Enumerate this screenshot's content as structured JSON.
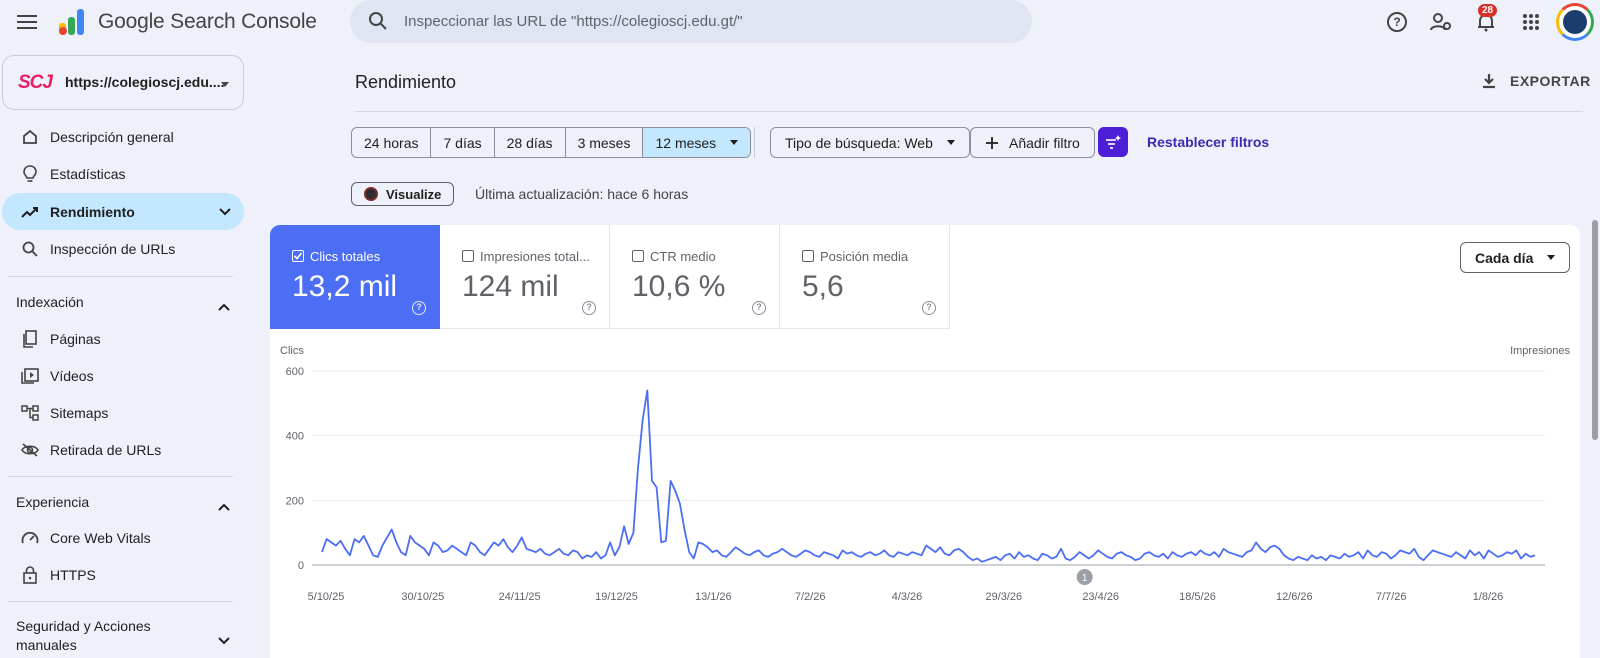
{
  "app": {
    "title": "Google Search Console"
  },
  "search": {
    "placeholder": "Inspeccionar las URL de \"https://colegioscj.edu.gt/\""
  },
  "header": {
    "notifications_count": "28"
  },
  "property": {
    "logo_text": "SCJ",
    "url": "https://colegioscj.edu...."
  },
  "sidebar": {
    "items": [
      {
        "label": "Descripción general",
        "icon": "home-icon"
      },
      {
        "label": "Estadísticas",
        "icon": "lightbulb-icon"
      },
      {
        "label": "Rendimiento",
        "icon": "trending-up-icon"
      },
      {
        "label": "Inspección de URLs",
        "icon": "search-icon"
      }
    ],
    "sections": [
      {
        "title": "Indexación",
        "items": [
          {
            "label": "Páginas",
            "icon": "pages-icon"
          },
          {
            "label": "Vídeos",
            "icon": "video-icon"
          },
          {
            "label": "Sitemaps",
            "icon": "sitemap-icon"
          },
          {
            "label": "Retirada de URLs",
            "icon": "eye-off-icon"
          }
        ]
      },
      {
        "title": "Experiencia",
        "items": [
          {
            "label": "Core Web Vitals",
            "icon": "gauge-icon"
          },
          {
            "label": "HTTPS",
            "icon": "lock-icon"
          }
        ]
      },
      {
        "title": "Seguridad y Acciones manuales",
        "items": []
      }
    ]
  },
  "main": {
    "title": "Rendimiento",
    "export_label": "EXPORTAR",
    "ranges": [
      "24 horas",
      "7 días",
      "28 días",
      "3 meses",
      "12 meses"
    ],
    "selected_range": "12 meses",
    "search_type": "Tipo de búsqueda: Web",
    "add_filter": "Añadir filtro",
    "reset_filters": "Restablecer filtros",
    "visualize": "Visualize",
    "last_update": "Última actualización: hace 6 horas",
    "period": "Cada día",
    "metrics": [
      {
        "label": "Clics totales",
        "value": "13,2 mil",
        "selected": true
      },
      {
        "label": "Impresiones total...",
        "value": "124 mil",
        "selected": false
      },
      {
        "label": "CTR medio",
        "value": "10,6 %",
        "selected": false
      },
      {
        "label": "Posición media",
        "value": "5,6",
        "selected": false
      }
    ],
    "accent_color": "#4c6ef5"
  },
  "chart_data": {
    "type": "line",
    "ylabel_left": "Clics",
    "ylabel_right": "Impresiones",
    "ylim": [
      0,
      600
    ],
    "yticks": [
      0,
      200,
      400,
      600
    ],
    "x_tick_labels": [
      "5/10/25",
      "30/10/25",
      "24/11/25",
      "19/12/25",
      "13/1/26",
      "7/2/26",
      "4/3/26",
      "29/3/26",
      "23/4/26",
      "18/5/26",
      "12/6/26",
      "7/7/26",
      "1/8/26"
    ],
    "annotation": "1",
    "series": [
      {
        "color": "#4c6ef5",
        "values": [
          40,
          80,
          70,
          60,
          75,
          50,
          30,
          80,
          70,
          90,
          60,
          30,
          25,
          60,
          85,
          110,
          70,
          40,
          30,
          90,
          70,
          60,
          50,
          30,
          70,
          60,
          40,
          45,
          60,
          50,
          40,
          30,
          70,
          60,
          40,
          30,
          50,
          70,
          60,
          80,
          55,
          40,
          60,
          85,
          50,
          45,
          40,
          50,
          35,
          30,
          40,
          50,
          35,
          30,
          45,
          40,
          20,
          30,
          25,
          40,
          20,
          30,
          70,
          30,
          55,
          120,
          65,
          100,
          300,
          450,
          540,
          260,
          240,
          70,
          75,
          260,
          230,
          190,
          110,
          40,
          20,
          70,
          65,
          55,
          40,
          45,
          30,
          25,
          40,
          55,
          45,
          35,
          30,
          40,
          45,
          30,
          25,
          35,
          40,
          50,
          40,
          30,
          25,
          35,
          45,
          40,
          30,
          25,
          40,
          35,
          30,
          20,
          45,
          35,
          40,
          30,
          25,
          35,
          40,
          30,
          35,
          45,
          30,
          25,
          40,
          35,
          30,
          40,
          35,
          30,
          60,
          50,
          40,
          55,
          35,
          30,
          45,
          50,
          40,
          25,
          15,
          20,
          10,
          15,
          20,
          25,
          15,
          30,
          35,
          20,
          40,
          25,
          30,
          20,
          15,
          35,
          30,
          20,
          25,
          50,
          20,
          15,
          25,
          40,
          30,
          20,
          30,
          45,
          35,
          25,
          20,
          35,
          40,
          30,
          25,
          15,
          20,
          35,
          40,
          30,
          25,
          35,
          20,
          40,
          30,
          25,
          35,
          40,
          30,
          45,
          35,
          30,
          40,
          25,
          50,
          40,
          35,
          30,
          25,
          40,
          45,
          70,
          50,
          40,
          55,
          60,
          50,
          30,
          20,
          15,
          25,
          20,
          15,
          30,
          20,
          25,
          15,
          30,
          25,
          20,
          35,
          25,
          30,
          40,
          20,
          45,
          30,
          25,
          40,
          35,
          20,
          30,
          45,
          40,
          35,
          50,
          25,
          15,
          30,
          45,
          40,
          35,
          30,
          25,
          40,
          30,
          20,
          45,
          30,
          40,
          20,
          45,
          35,
          25,
          30,
          40,
          35,
          45,
          20,
          35,
          25,
          30
        ]
      }
    ]
  }
}
